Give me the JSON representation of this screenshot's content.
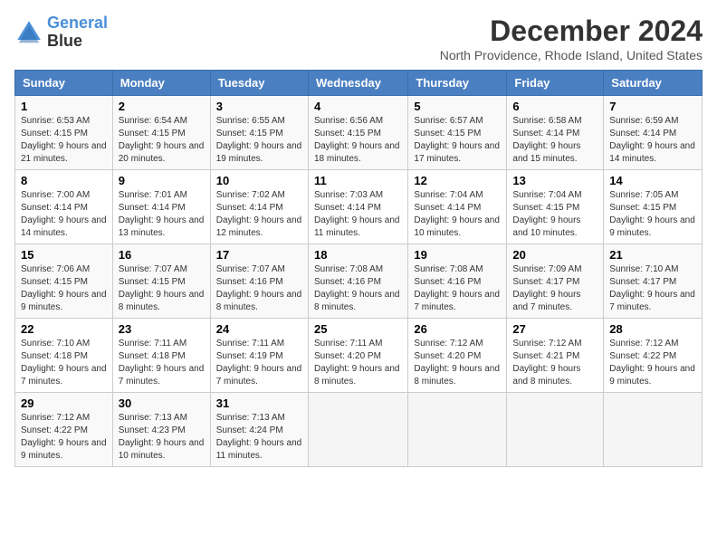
{
  "logo": {
    "line1": "General",
    "line2": "Blue"
  },
  "title": "December 2024",
  "subtitle": "North Providence, Rhode Island, United States",
  "days_header": [
    "Sunday",
    "Monday",
    "Tuesday",
    "Wednesday",
    "Thursday",
    "Friday",
    "Saturday"
  ],
  "weeks": [
    [
      {
        "day": "1",
        "sunrise": "6:53 AM",
        "sunset": "4:15 PM",
        "daylight": "9 hours and 21 minutes."
      },
      {
        "day": "2",
        "sunrise": "6:54 AM",
        "sunset": "4:15 PM",
        "daylight": "9 hours and 20 minutes."
      },
      {
        "day": "3",
        "sunrise": "6:55 AM",
        "sunset": "4:15 PM",
        "daylight": "9 hours and 19 minutes."
      },
      {
        "day": "4",
        "sunrise": "6:56 AM",
        "sunset": "4:15 PM",
        "daylight": "9 hours and 18 minutes."
      },
      {
        "day": "5",
        "sunrise": "6:57 AM",
        "sunset": "4:15 PM",
        "daylight": "9 hours and 17 minutes."
      },
      {
        "day": "6",
        "sunrise": "6:58 AM",
        "sunset": "4:14 PM",
        "daylight": "9 hours and 15 minutes."
      },
      {
        "day": "7",
        "sunrise": "6:59 AM",
        "sunset": "4:14 PM",
        "daylight": "9 hours and 14 minutes."
      }
    ],
    [
      {
        "day": "8",
        "sunrise": "7:00 AM",
        "sunset": "4:14 PM",
        "daylight": "9 hours and 14 minutes."
      },
      {
        "day": "9",
        "sunrise": "7:01 AM",
        "sunset": "4:14 PM",
        "daylight": "9 hours and 13 minutes."
      },
      {
        "day": "10",
        "sunrise": "7:02 AM",
        "sunset": "4:14 PM",
        "daylight": "9 hours and 12 minutes."
      },
      {
        "day": "11",
        "sunrise": "7:03 AM",
        "sunset": "4:14 PM",
        "daylight": "9 hours and 11 minutes."
      },
      {
        "day": "12",
        "sunrise": "7:04 AM",
        "sunset": "4:14 PM",
        "daylight": "9 hours and 10 minutes."
      },
      {
        "day": "13",
        "sunrise": "7:04 AM",
        "sunset": "4:15 PM",
        "daylight": "9 hours and 10 minutes."
      },
      {
        "day": "14",
        "sunrise": "7:05 AM",
        "sunset": "4:15 PM",
        "daylight": "9 hours and 9 minutes."
      }
    ],
    [
      {
        "day": "15",
        "sunrise": "7:06 AM",
        "sunset": "4:15 PM",
        "daylight": "9 hours and 9 minutes."
      },
      {
        "day": "16",
        "sunrise": "7:07 AM",
        "sunset": "4:15 PM",
        "daylight": "9 hours and 8 minutes."
      },
      {
        "day": "17",
        "sunrise": "7:07 AM",
        "sunset": "4:16 PM",
        "daylight": "9 hours and 8 minutes."
      },
      {
        "day": "18",
        "sunrise": "7:08 AM",
        "sunset": "4:16 PM",
        "daylight": "9 hours and 8 minutes."
      },
      {
        "day": "19",
        "sunrise": "7:08 AM",
        "sunset": "4:16 PM",
        "daylight": "9 hours and 7 minutes."
      },
      {
        "day": "20",
        "sunrise": "7:09 AM",
        "sunset": "4:17 PM",
        "daylight": "9 hours and 7 minutes."
      },
      {
        "day": "21",
        "sunrise": "7:10 AM",
        "sunset": "4:17 PM",
        "daylight": "9 hours and 7 minutes."
      }
    ],
    [
      {
        "day": "22",
        "sunrise": "7:10 AM",
        "sunset": "4:18 PM",
        "daylight": "9 hours and 7 minutes."
      },
      {
        "day": "23",
        "sunrise": "7:11 AM",
        "sunset": "4:18 PM",
        "daylight": "9 hours and 7 minutes."
      },
      {
        "day": "24",
        "sunrise": "7:11 AM",
        "sunset": "4:19 PM",
        "daylight": "9 hours and 7 minutes."
      },
      {
        "day": "25",
        "sunrise": "7:11 AM",
        "sunset": "4:20 PM",
        "daylight": "9 hours and 8 minutes."
      },
      {
        "day": "26",
        "sunrise": "7:12 AM",
        "sunset": "4:20 PM",
        "daylight": "9 hours and 8 minutes."
      },
      {
        "day": "27",
        "sunrise": "7:12 AM",
        "sunset": "4:21 PM",
        "daylight": "9 hours and 8 minutes."
      },
      {
        "day": "28",
        "sunrise": "7:12 AM",
        "sunset": "4:22 PM",
        "daylight": "9 hours and 9 minutes."
      }
    ],
    [
      {
        "day": "29",
        "sunrise": "7:12 AM",
        "sunset": "4:22 PM",
        "daylight": "9 hours and 9 minutes."
      },
      {
        "day": "30",
        "sunrise": "7:13 AM",
        "sunset": "4:23 PM",
        "daylight": "9 hours and 10 minutes."
      },
      {
        "day": "31",
        "sunrise": "7:13 AM",
        "sunset": "4:24 PM",
        "daylight": "9 hours and 11 minutes."
      },
      null,
      null,
      null,
      null
    ]
  ]
}
